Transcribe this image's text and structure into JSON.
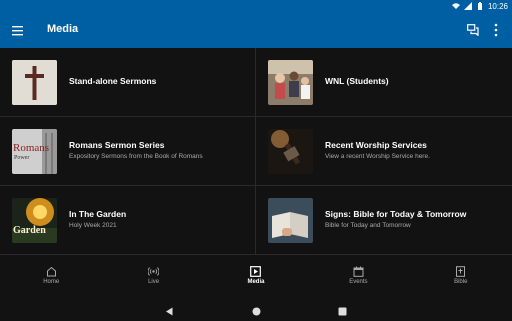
{
  "status": {
    "time": "10:26"
  },
  "app": {
    "title": "Media"
  },
  "items": [
    {
      "title": "Stand-alone Sermons",
      "subtitle": "",
      "thumb": "cross-thumbnail"
    },
    {
      "title": "WNL (Students)",
      "subtitle": "",
      "thumb": "students-thumbnail"
    },
    {
      "title": "Romans Sermon Series",
      "subtitle": "Expository Sermons from the Book of Romans",
      "thumb": "romans-thumbnail",
      "thumb_text": "Romans",
      "thumb_sub": "Power"
    },
    {
      "title": "Recent Worship Services",
      "subtitle": "View a recent Worship Service here.",
      "thumb": "worship-thumbnail"
    },
    {
      "title": "In The Garden",
      "subtitle": "Holy Week 2021",
      "thumb": "garden-thumbnail",
      "thumb_text": "Garden"
    },
    {
      "title": "Signs: Bible for Today & Tomorrow",
      "subtitle": "Bible for Today and Tomorrow",
      "thumb": "bible-thumbnail"
    }
  ],
  "nav": [
    {
      "label": "Home",
      "icon": "home-icon"
    },
    {
      "label": "Live",
      "icon": "live-icon"
    },
    {
      "label": "Media",
      "icon": "media-icon",
      "active": true
    },
    {
      "label": "Events",
      "icon": "events-icon"
    },
    {
      "label": "Bible",
      "icon": "bible-icon"
    }
  ],
  "colors": {
    "app_bar": "#005fa3",
    "background": "#121212"
  }
}
